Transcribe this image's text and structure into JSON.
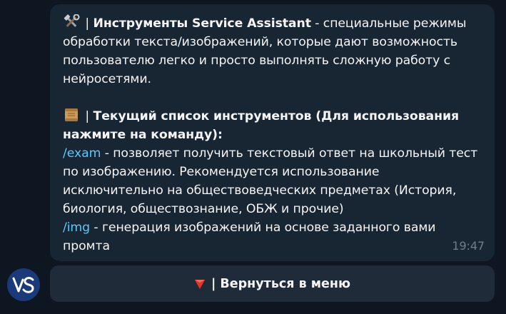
{
  "message": {
    "p1_sep": " | ",
    "p1_title": "Инструменты Service Assistant",
    "p1_rest": " - специальные режимы обработки текста/изображений, которые дают возможность пользователю легко и просто выполнять сложную работу с нейросетями.",
    "p2_sep": " | ",
    "p2_title": "Текущий список инструментов (Для использования нажмите на команду):",
    "cmd1": "/exam",
    "cmd1_desc": " - позволяет получить текстовый ответ на школьный тест по изображению. Рекомендуется использование исключительно на обществоведческих предметах (История, биология, обществознание, ОБЖ и прочие)",
    "cmd2": "/img",
    "cmd2_desc": " - генерация изображений на основе заданного вами промта",
    "time": "19:47"
  },
  "keyboard": {
    "button_label": "| Вернуться в меню"
  },
  "icons": {
    "tools": "hammer-and-wrench-icon",
    "scroll": "scroll-icon",
    "triangle": "red-triangle-down-icon",
    "avatar": "vs-logo-avatar"
  },
  "colors": {
    "background": "#0e1621",
    "bubble": "#182533",
    "command_link": "#5ac8fb",
    "timestamp": "#6d7f8f",
    "keyboard_button": "#1f2b38"
  }
}
